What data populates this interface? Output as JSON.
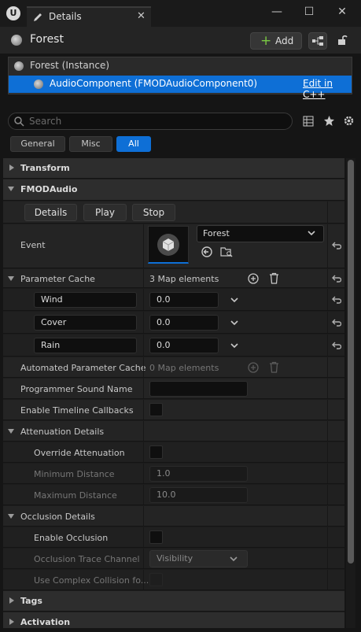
{
  "window": {
    "tab_title": "Details",
    "close_glyph": "✕",
    "minimize_glyph": "—",
    "maximize_glyph": "☐",
    "window_close_glyph": "✕"
  },
  "header": {
    "actor_name": "Forest",
    "add_label": "Add"
  },
  "components": {
    "instance_label": "Forest (Instance)",
    "selected_label": "AudioComponent (FMODAudioComponent0)",
    "edit_link": "Edit in C++"
  },
  "search": {
    "placeholder": "Search"
  },
  "filters": {
    "general": "General",
    "misc": "Misc",
    "all": "All",
    "active": "All"
  },
  "sections": {
    "transform": "Transform",
    "fmod": "FMODAudio",
    "attenuation": "Attenuation Details",
    "occlusion": "Occlusion Details",
    "tags": "Tags",
    "activation": "Activation"
  },
  "fmod_buttons": {
    "details": "Details",
    "play": "Play",
    "stop": "Stop"
  },
  "event": {
    "label": "Event",
    "value": "Forest"
  },
  "parameter_cache": {
    "label": "Parameter Cache",
    "count_text": "3 Map elements",
    "entries": [
      {
        "key": "Wind",
        "value": "0.0"
      },
      {
        "key": "Cover",
        "value": "0.0"
      },
      {
        "key": "Rain",
        "value": "0.0"
      }
    ]
  },
  "automated_cache": {
    "label": "Automated Parameter Cache",
    "count_text": "0 Map elements"
  },
  "programmer_sound": {
    "label": "Programmer Sound Name",
    "value": ""
  },
  "timeline_callbacks": {
    "label": "Enable Timeline Callbacks"
  },
  "attenuation": {
    "override_label": "Override Attenuation",
    "min_label": "Minimum Distance",
    "min_value": "1.0",
    "max_label": "Maximum Distance",
    "max_value": "10.0"
  },
  "occlusion": {
    "enable_label": "Enable Occlusion",
    "trace_label": "Occlusion Trace Channel",
    "trace_value": "Visibility",
    "complex_label": "Use Complex Collision fo..."
  },
  "colors": {
    "accent": "#0e6fd6",
    "add_plus": "#7ac943"
  }
}
